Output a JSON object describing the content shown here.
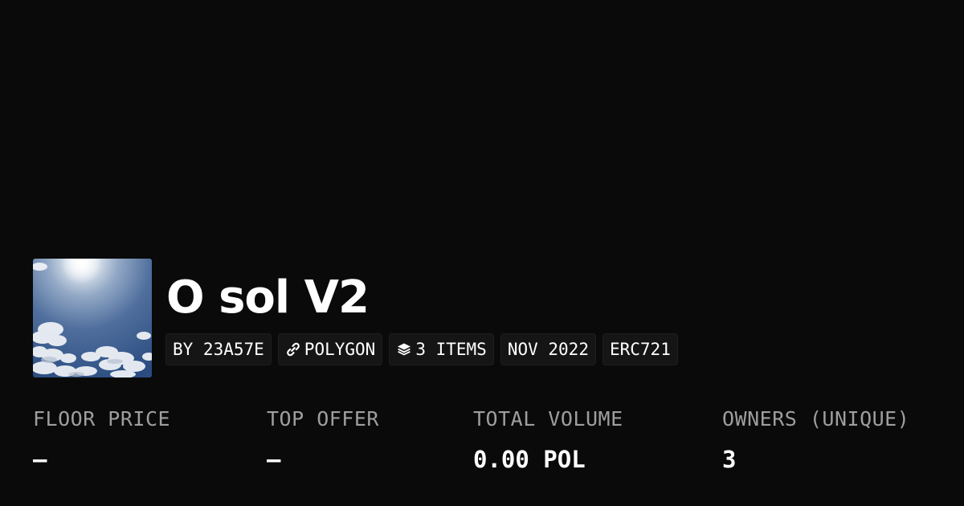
{
  "collection": {
    "image_icon": "sky-with-sun-and-clouds",
    "title": "O sol V2"
  },
  "badges": [
    {
      "text": "BY 23A57E",
      "icon": null
    },
    {
      "text": "POLYGON",
      "icon": "chain-link-icon"
    },
    {
      "text": "3 ITEMS",
      "icon": "layers-icon"
    },
    {
      "text": "NOV 2022",
      "icon": null
    },
    {
      "text": "ERC721",
      "icon": null
    }
  ],
  "stats": [
    {
      "label": "FLOOR PRICE",
      "value": "—"
    },
    {
      "label": "TOP OFFER",
      "value": "—"
    },
    {
      "label": "TOTAL VOLUME",
      "value": "0.00 POL"
    },
    {
      "label": "OWNERS (UNIQUE)",
      "value": "3"
    }
  ],
  "colors": {
    "background": "#0a0a0a",
    "badge_background": "#151515",
    "label": "#9e9e9e",
    "text": "#ffffff"
  }
}
